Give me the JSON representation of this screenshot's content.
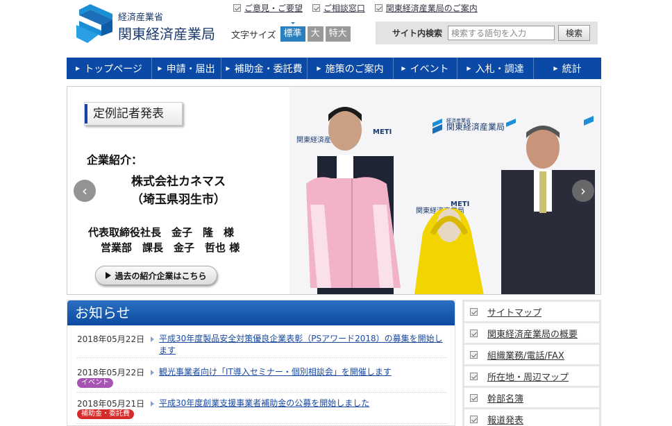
{
  "header": {
    "logo_small": "経済産業省",
    "logo_big": "関東経済産業局",
    "toplinks": [
      "ご意見・ご要望",
      "ご相談窓口",
      "関東経済産業局のご案内"
    ],
    "font_size_label": "文字サイズ",
    "font_sizes": [
      "標準",
      "大",
      "特大"
    ],
    "search_label": "サイト内検索",
    "search_placeholder": "検索する語句を入力",
    "search_button": "検索"
  },
  "nav": [
    "トップページ",
    "申請・届出",
    "補助金・委託費",
    "施策のご案内",
    "イベント",
    "入札・調達",
    "統計"
  ],
  "hero": {
    "badge": "定例記者発表",
    "intro_label": "企業紹介：",
    "company_line1": "株式会社カネマス",
    "company_line2": "（埼玉県羽生市）",
    "person1": "代表取締役社長　金子　隆　様",
    "person2": "営業部　課長　金子　哲也 様",
    "past_button": "過去の紹介企業はこちら",
    "photo_banner_text": "関東経済産業局",
    "photo_banner_small": "経済産業省",
    "photo_meti": "METI"
  },
  "news": {
    "title": "お知らせ",
    "items": [
      {
        "date": "2018年05月22日",
        "title": "平成30年度製品安全対策優良企業表彰（PSアワード2018）の募集を開始します",
        "tag": ""
      },
      {
        "date": "2018年05月22日",
        "title": "観光事業者向け「IT導入セミナー・個別相談会」を開催します",
        "tag": "イベント"
      },
      {
        "date": "2018年05月21日",
        "title": "平成30年度創業支援事業者補助金の公募を開始しました",
        "tag": "補助金・委託費"
      }
    ]
  },
  "sidebar": [
    "サイトマップ",
    "関東経済産業局の概要",
    "組織業務/電話/FAX",
    "所在地・周辺マップ",
    "幹部名簿",
    "報道発表"
  ],
  "colors": {
    "nav": "#0a49a6",
    "accent": "#2a7fbf",
    "event_tag": "#a653b3",
    "subsidy_tag": "#d62b2b"
  }
}
